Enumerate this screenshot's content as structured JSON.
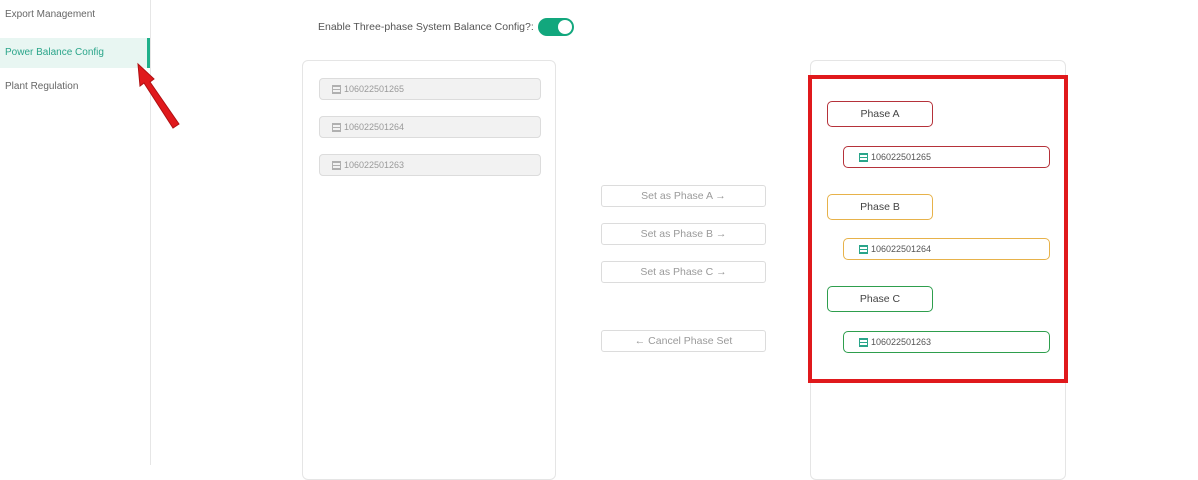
{
  "sidebar": {
    "items": [
      {
        "label": "Export Management",
        "active": false
      },
      {
        "label": "Power Balance Config",
        "active": true
      },
      {
        "label": "Plant Regulation",
        "active": false
      }
    ]
  },
  "toggle": {
    "label": "Enable Three-phase System Balance Config?:",
    "enabled": true
  },
  "left_panel": {
    "devices": [
      "106022501265",
      "106022501264",
      "106022501263"
    ]
  },
  "actions": {
    "set_a": "Set as Phase A →",
    "set_b": "Set as Phase B →",
    "set_c": "Set as Phase C →",
    "cancel": "← Cancel Phase Set"
  },
  "right_panel": {
    "phases": [
      {
        "label": "Phase A",
        "device": "106022501265",
        "color": "#b5323a"
      },
      {
        "label": "Phase B",
        "device": "106022501264",
        "color": "#e7b24a"
      },
      {
        "label": "Phase C",
        "device": "106022501263",
        "color": "#2e9e4d"
      }
    ]
  },
  "colors": {
    "accent": "#12a77d",
    "highlight": "#e0191c"
  }
}
